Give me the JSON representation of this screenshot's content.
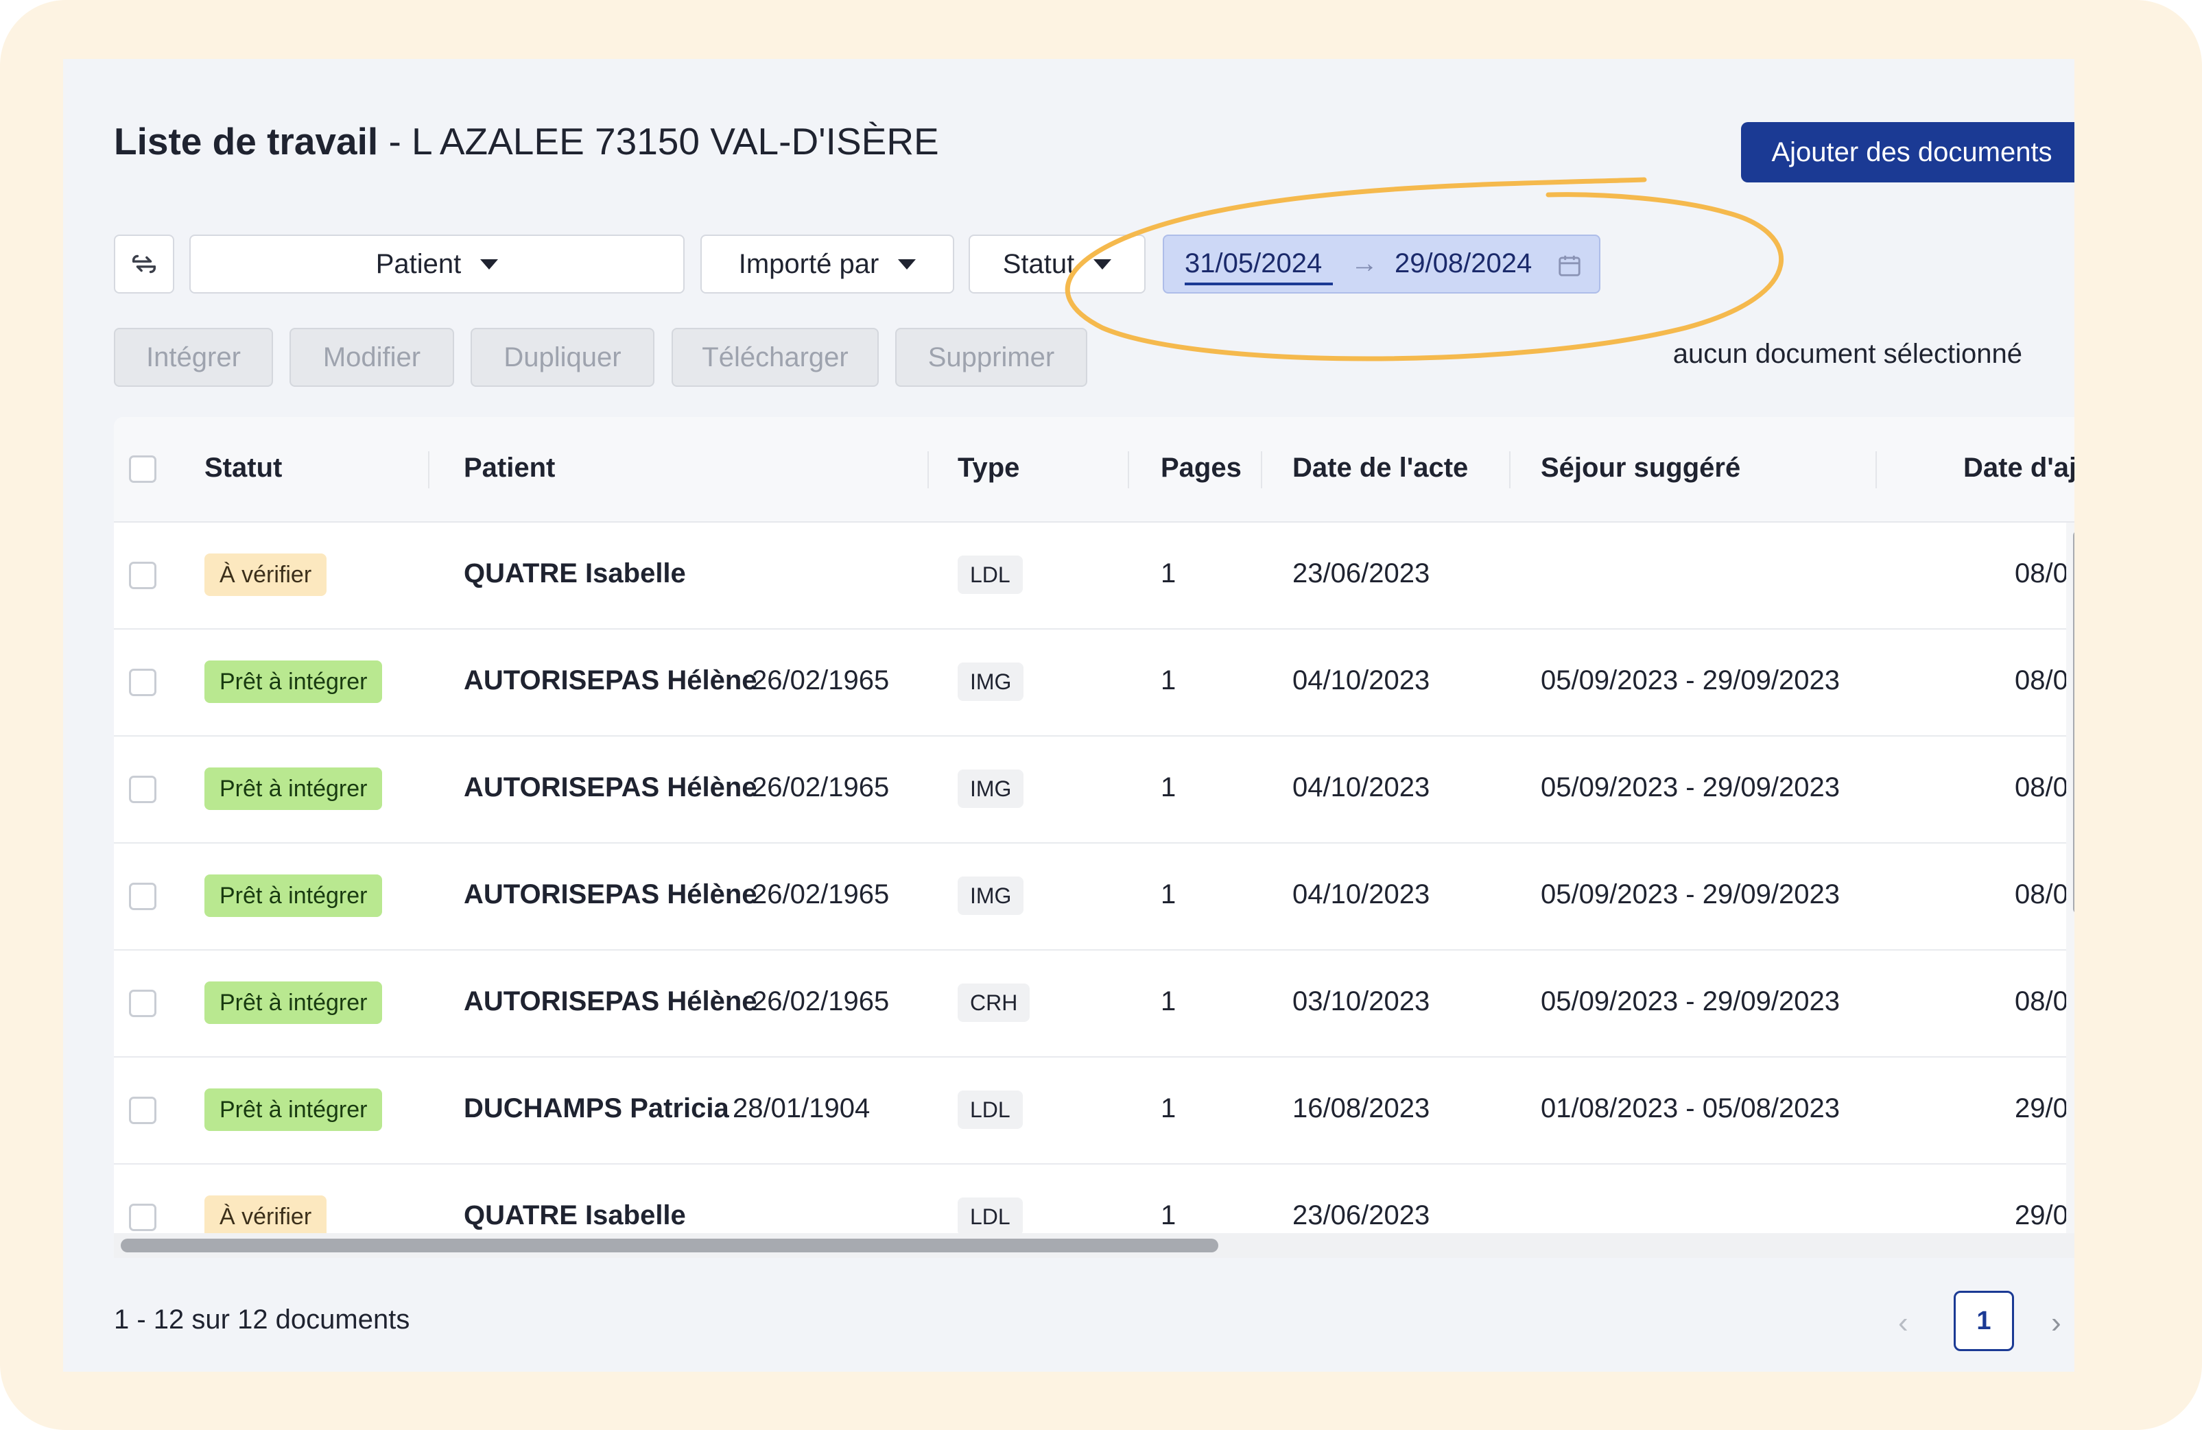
{
  "header": {
    "title": "Liste de travail",
    "subtitle": " - L AZALEE 73150 VAL-D'ISÈRE",
    "add_button": "Ajouter des documents"
  },
  "filters": {
    "refresh_icon": "refresh-icon",
    "patient": "Patient",
    "imported_by": "Importé par",
    "status": "Statut",
    "date_from": "31/05/2024",
    "date_to": "29/08/2024",
    "date_arrow": "→",
    "calendar_icon": "calendar-icon"
  },
  "annotation": {
    "color": "#f5b94d"
  },
  "actions": {
    "integrate": "Intégrer",
    "edit": "Modifier",
    "duplicate": "Dupliquer",
    "download": "Télécharger",
    "delete": "Supprimer",
    "selection": "aucun document sélectionné"
  },
  "table": {
    "columns": {
      "status": "Statut",
      "patient": "Patient",
      "type": "Type",
      "pages": "Pages",
      "act_date": "Date de l'acte",
      "stay": "Séjour suggéré",
      "added_date": "Date d'ajo"
    },
    "rows": [
      {
        "status": "À vérifier",
        "status_kind": "verify",
        "name": "QUATRE Isabelle",
        "dob": "",
        "type": "LDL",
        "pages": "1",
        "act_date": "23/06/2023",
        "stay": "",
        "added": "08/0"
      },
      {
        "status": "Prêt à intégrer",
        "status_kind": "ready",
        "name": "AUTORISEPAS Hélène",
        "dob": "26/02/1965",
        "type": "IMG",
        "pages": "1",
        "act_date": "04/10/2023",
        "stay": "05/09/2023 - 29/09/2023",
        "added": "08/0"
      },
      {
        "status": "Prêt à intégrer",
        "status_kind": "ready",
        "name": "AUTORISEPAS Hélène",
        "dob": "26/02/1965",
        "type": "IMG",
        "pages": "1",
        "act_date": "04/10/2023",
        "stay": "05/09/2023 - 29/09/2023",
        "added": "08/0"
      },
      {
        "status": "Prêt à intégrer",
        "status_kind": "ready",
        "name": "AUTORISEPAS Hélène",
        "dob": "26/02/1965",
        "type": "IMG",
        "pages": "1",
        "act_date": "04/10/2023",
        "stay": "05/09/2023 - 29/09/2023",
        "added": "08/0"
      },
      {
        "status": "Prêt à intégrer",
        "status_kind": "ready",
        "name": "AUTORISEPAS Hélène",
        "dob": "26/02/1965",
        "type": "CRH",
        "pages": "1",
        "act_date": "03/10/2023",
        "stay": "05/09/2023 - 29/09/2023",
        "added": "08/0"
      },
      {
        "status": "Prêt à intégrer",
        "status_kind": "ready",
        "name": "DUCHAMPS Patricia",
        "dob": "28/01/1904",
        "type": "LDL",
        "pages": "1",
        "act_date": "16/08/2023",
        "stay": "01/08/2023 - 05/08/2023",
        "added": "29/0"
      },
      {
        "status": "À vérifier",
        "status_kind": "verify",
        "name": "QUATRE Isabelle",
        "dob": "",
        "type": "LDL",
        "pages": "1",
        "act_date": "23/06/2023",
        "stay": "",
        "added": "29/0"
      }
    ]
  },
  "footer": {
    "count": "1 - 12 sur 12 documents",
    "prev": "‹",
    "page": "1",
    "next": "›"
  }
}
